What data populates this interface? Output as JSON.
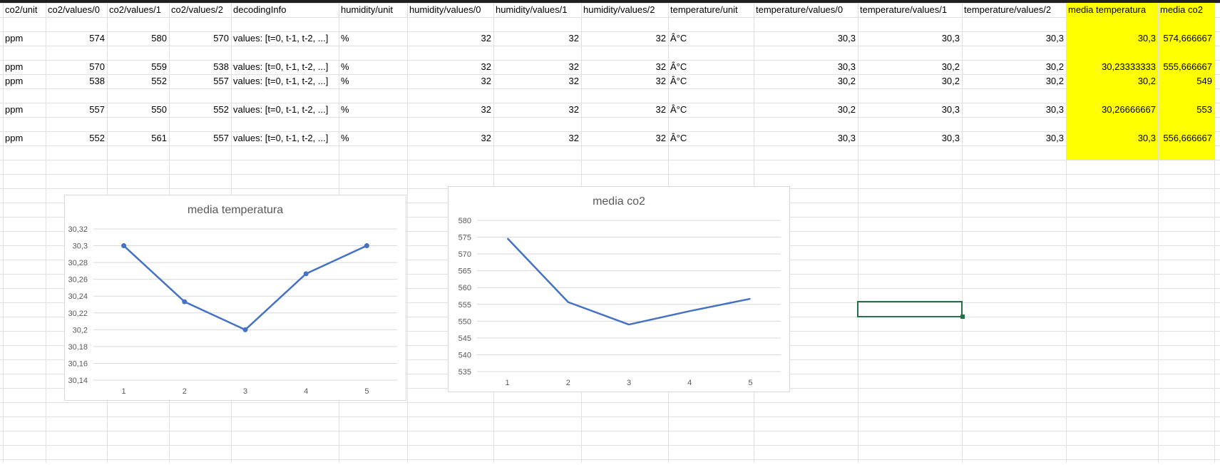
{
  "sheet": {
    "headers": [
      "co2/unit",
      "co2/values/0",
      "co2/values/1",
      "co2/values/2",
      "decodingInfo",
      "humidity/unit",
      "humidity/values/0",
      "humidity/values/1",
      "humidity/values/2",
      "temperature/unit",
      "temperature/values/0",
      "temperature/values/1",
      "temperature/values/2",
      "media temperatura",
      "media co2"
    ],
    "rows": [
      [
        "ppm",
        "574",
        "580",
        "570",
        "values: [t=0, t-1, t-2, ...]",
        "%",
        "32",
        "32",
        "32",
        "Â°C",
        "30,3",
        "30,3",
        "30,3",
        "30,3",
        "574,666667"
      ],
      [
        "ppm",
        "570",
        "559",
        "538",
        "values: [t=0, t-1, t-2, ...]",
        "%",
        "32",
        "32",
        "32",
        "Â°C",
        "30,3",
        "30,2",
        "30,2",
        "30,23333333",
        "555,666667"
      ],
      [
        "ppm",
        "538",
        "552",
        "557",
        "values: [t=0, t-1, t-2, ...]",
        "%",
        "32",
        "32",
        "32",
        "Â°C",
        "30,2",
        "30,2",
        "30,2",
        "30,2",
        "549"
      ],
      [
        "ppm",
        "557",
        "550",
        "552",
        "values: [t=0, t-1, t-2, ...]",
        "%",
        "32",
        "32",
        "32",
        "Â°C",
        "30,2",
        "30,3",
        "30,3",
        "30,26666667",
        "553"
      ],
      [
        "ppm",
        "552",
        "561",
        "557",
        "values: [t=0, t-1, t-2, ...]",
        "%",
        "32",
        "32",
        "32",
        "Â°C",
        "30,3",
        "30,3",
        "30,3",
        "30,3",
        "556,666667"
      ]
    ],
    "highlight_color": "#ffff00"
  },
  "chart_data": [
    {
      "type": "line",
      "title": "media temperatura",
      "categories": [
        "1",
        "2",
        "3",
        "4",
        "5"
      ],
      "values": [
        30.3,
        30.23333333,
        30.2,
        30.26666667,
        30.3
      ],
      "yticks": [
        "30,32",
        "30,3",
        "30,28",
        "30,26",
        "30,24",
        "30,22",
        "30,2",
        "30,18",
        "30,16",
        "30,14"
      ],
      "ylim": [
        30.14,
        30.32
      ],
      "markers": true,
      "color": "#4472c4",
      "grid": true
    },
    {
      "type": "line",
      "title": "media co2",
      "categories": [
        "1",
        "2",
        "3",
        "4",
        "5"
      ],
      "values": [
        574.666667,
        555.666667,
        549,
        553,
        556.666667
      ],
      "yticks": [
        "580",
        "575",
        "570",
        "565",
        "560",
        "555",
        "550",
        "545",
        "540",
        "535"
      ],
      "ylim": [
        535,
        580
      ],
      "markers": false,
      "color": "#4472c4",
      "grid": true
    }
  ]
}
